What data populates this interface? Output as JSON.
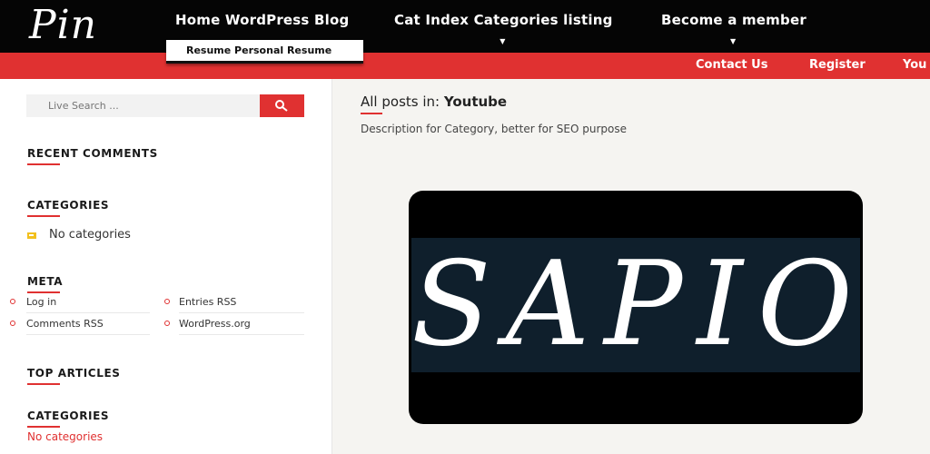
{
  "header": {
    "logo_text": "Pin",
    "nav": [
      {
        "label": "Home WordPress Blog"
      },
      {
        "label": "Cat Index Categories listing"
      },
      {
        "label": "Become a member"
      }
    ],
    "dropdown_item": "Resume Personal Resume"
  },
  "secondary_nav": [
    {
      "label": "Contact Us"
    },
    {
      "label": "Register"
    },
    {
      "label": "You"
    }
  ],
  "sidebar": {
    "search_placeholder": "Live Search ...",
    "search_icon": "search-icon",
    "recent_comments_title": "RECENT COMMENTS",
    "categories_title": "CATEGORIES",
    "no_categories": "No categories",
    "meta_title": "META",
    "meta_links": [
      {
        "label": "Log in"
      },
      {
        "label": "Entries RSS"
      },
      {
        "label": "Comments RSS"
      },
      {
        "label": "WordPress.org"
      }
    ],
    "top_articles_title": "TOP ARTICLES",
    "categories2_title": "CATEGORIES",
    "no_categories2": "No categories"
  },
  "main": {
    "heading_prefix": "All posts in:",
    "heading_category": "Youtube",
    "description": "Description for Category, better for SEO purpose",
    "thumbnail_text": "SAPIO"
  },
  "colors": {
    "accent": "#e03131",
    "header_bg": "#050505",
    "thumbnail_band": "#0f1f2c"
  }
}
